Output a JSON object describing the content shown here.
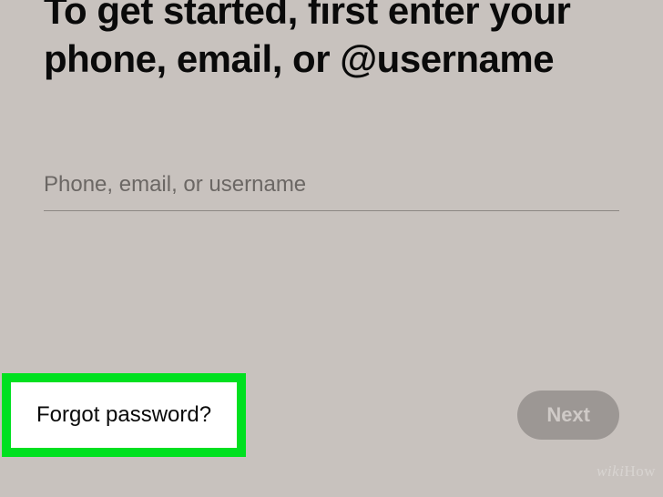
{
  "heading": "To get started, first enter your phone, email, or @username",
  "input": {
    "placeholder": "Phone, email, or username",
    "value": ""
  },
  "actions": {
    "forgot_label": "Forgot password?",
    "next_label": "Next"
  },
  "watermark": {
    "prefix": "wiki",
    "suffix": "How"
  },
  "highlight": {
    "target": "forgot-password-link",
    "color": "#00e020"
  }
}
